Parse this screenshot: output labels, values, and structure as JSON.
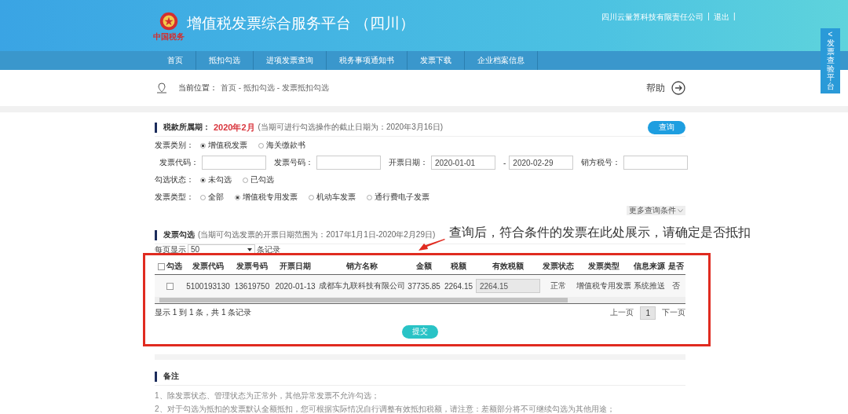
{
  "header": {
    "logo_text": "中国税务",
    "title": "增值税发票综合服务平台 （四川）",
    "company": "四川云量算科技有限责任公司",
    "separator_1": "|",
    "logout": "退出",
    "separator_2": "|"
  },
  "side_tab": {
    "arrow": "<",
    "label": "发票查验平台"
  },
  "nav": [
    {
      "label": "首页",
      "selected": false
    },
    {
      "label": "抵扣勾选",
      "selected": false
    },
    {
      "label": "进项发票查询",
      "selected": false
    },
    {
      "label": "税务事项通知书",
      "selected": false
    },
    {
      "label": "发票下载",
      "selected": false
    },
    {
      "label": "企业档案信息",
      "selected": false
    }
  ],
  "breadcrumb": {
    "label": "当前位置：",
    "path": "首页 - 抵扣勾选 - 发票抵扣勾选",
    "help": "帮助"
  },
  "period": {
    "label": "税款所属期：",
    "value": "2020年2月",
    "note": "(当期可进行勾选操作的截止日期为：2020年3月16日)",
    "query_button": "查询"
  },
  "filters": [
    {
      "label": "发票类别：",
      "items": [
        {
          "kind": "radio",
          "label": "增值税发票",
          "selected": true
        },
        {
          "kind": "radio",
          "label": "海关缴款书",
          "selected": false
        }
      ]
    },
    {
      "items": [
        {
          "kind": "field",
          "label": "发票代码："
        },
        {
          "kind": "field",
          "label": "发票号码："
        },
        {
          "kind": "field",
          "label": "开票日期：",
          "value": "2020-01-01"
        },
        {
          "kind": "field",
          "label": "-",
          "value": "2020-02-29"
        },
        {
          "kind": "field",
          "label": "销方税号："
        }
      ]
    },
    {
      "label": "勾选状态：",
      "items": [
        {
          "kind": "radio",
          "label": "未勾选",
          "selected": true
        },
        {
          "kind": "radio",
          "label": "已勾选",
          "selected": false
        }
      ]
    },
    {
      "label": "发票类型：",
      "items": [
        {
          "kind": "radio",
          "label": "全部",
          "selected": false
        },
        {
          "kind": "radio",
          "label": "增值税专用发票",
          "selected": true
        },
        {
          "kind": "radio",
          "label": "机动车发票",
          "selected": false
        },
        {
          "kind": "radio",
          "label": "通行费电子发票",
          "selected": false
        }
      ]
    }
  ],
  "more_conditions": "更多查询条件",
  "selection": {
    "title": "发票勾选",
    "note": "(当期可勾选发票的开票日期范围为：2017年1月1日-2020年2月29日)",
    "page_size_prefix": "每页显示",
    "page_size": "50",
    "page_size_suffix": "条记录",
    "select_all_checked": false,
    "columns": [
      "勾选",
      "发票代码",
      "发票号码",
      "开票日期",
      "销方名称",
      "金额",
      "税额",
      "有效税额",
      "发票状态",
      "发票类型",
      "信息来源",
      "是否"
    ],
    "rows": [
      {
        "cells": [
          {
            "kind": "checkbox",
            "checked": false
          },
          {
            "kind": "text",
            "text": "5100193130"
          },
          {
            "kind": "text",
            "text": "13619750"
          },
          {
            "kind": "text",
            "text": "2020-01-13"
          },
          {
            "kind": "text",
            "text": "成都车九联科技有限公司"
          },
          {
            "kind": "text",
            "text": "37735.85"
          },
          {
            "kind": "text",
            "text": "2264.15"
          },
          {
            "kind": "input",
            "text": "2264.15"
          },
          {
            "kind": "text",
            "text": "正常"
          },
          {
            "kind": "text",
            "text": "增值税专用发票"
          },
          {
            "kind": "text",
            "text": "系统推送"
          },
          {
            "kind": "text",
            "text": "否"
          }
        ]
      }
    ],
    "summary": "显示 1 到 1 条，共 1 条记录",
    "prev": "上一页",
    "pages": [
      {
        "label": "1",
        "selected": true
      }
    ],
    "next": "下一页",
    "submit": "提交"
  },
  "notes": {
    "title": "备注",
    "items": [
      "1、除发票状态、管理状态为正常外，其他异常发票不允许勾选；",
      "2、对于勾选为抵扣的发票默认全额抵扣，您可根据实际情况自行调整有效抵扣税额，请注意：差额部分将不可继续勾选为其他用途；"
    ]
  },
  "annotation": "查询后，符合条件的发票在此处展示，请确定是否抵扣"
}
